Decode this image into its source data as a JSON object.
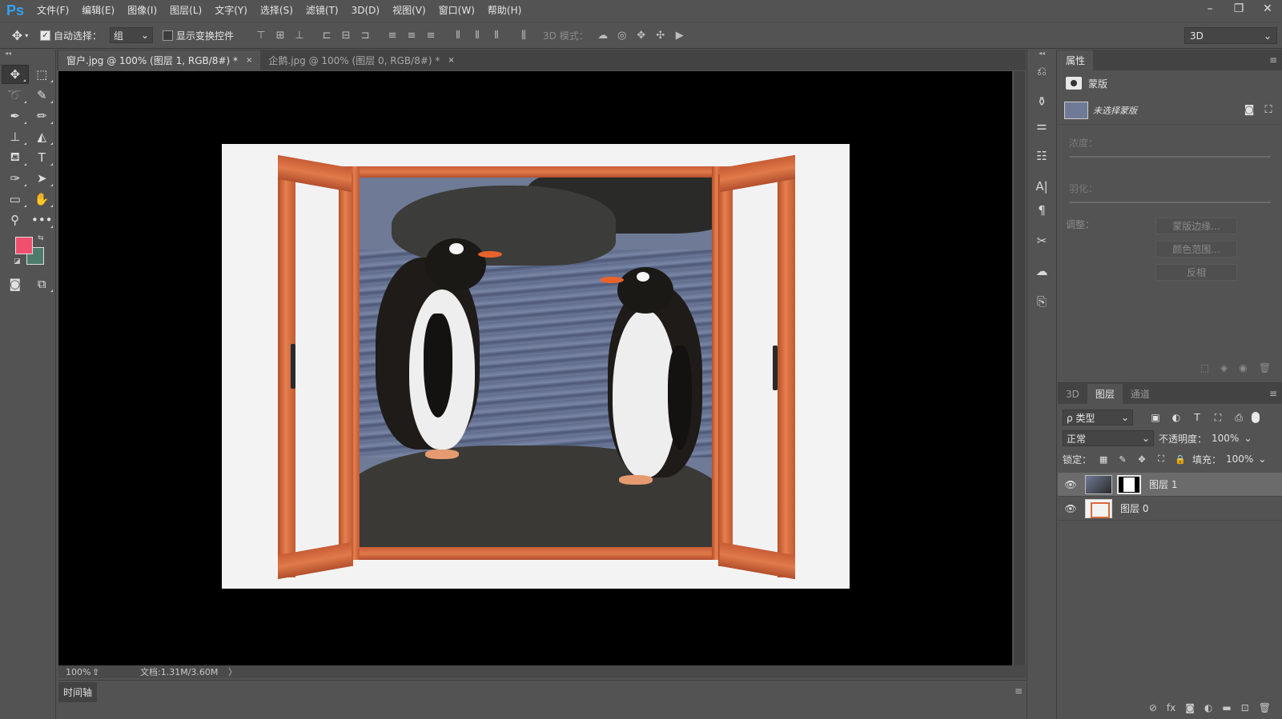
{
  "app": {
    "logo": "Ps",
    "menu": [
      "文件(F)",
      "编辑(E)",
      "图像(I)",
      "图层(L)",
      "文字(Y)",
      "选择(S)",
      "滤镜(T)",
      "3D(D)",
      "视图(V)",
      "窗口(W)",
      "帮助(H)"
    ],
    "window_controls": [
      "–",
      "❐",
      "✕"
    ]
  },
  "options": {
    "auto_select_label": "自动选择：",
    "auto_select_checked": true,
    "auto_select_value": "组",
    "show_transform_label": "显示变换控件",
    "mode_3d_label": "3D 模式：",
    "workspace": "3D"
  },
  "documents": {
    "tabs": [
      {
        "label": "窗户.jpg @ 100% (图层 1, RGB/8#) *",
        "close": "×",
        "active": true
      },
      {
        "label": "企鹅.jpg @ 100% (图层 0, RGB/8#) *",
        "close": "×",
        "active": false
      }
    ]
  },
  "status": {
    "zoom": "100%",
    "doc_info": "文档:1.31M/3.60M",
    "arrow": "〉"
  },
  "timeline": {
    "tab": "时间轴",
    "menu": "≡"
  },
  "colors": {
    "foreground": "#f0506e",
    "background": "#4e7b6c",
    "canvas": "#000000",
    "accent_logo": "#33a3f1"
  },
  "properties": {
    "tab": "属性",
    "header": "蒙版",
    "mask_label": "未选择蒙版",
    "density_label": "浓度：",
    "feather_label": "羽化：",
    "adjust_label": "调整：",
    "buttons": [
      "蒙版边缘...",
      "颜色范围...",
      "反相"
    ]
  },
  "layers_panel": {
    "tabs": [
      {
        "label": "3D",
        "active": false
      },
      {
        "label": "图层",
        "active": true
      },
      {
        "label": "通道",
        "active": false
      }
    ],
    "filter_label": "ρ 类型",
    "blend_mode": "正常",
    "opacity_label": "不透明度：",
    "opacity_value": "100%",
    "lock_label": "锁定：",
    "fill_label": "填充：",
    "fill_value": "100%",
    "layers": [
      {
        "name": "图层 1",
        "selected": true,
        "has_mask": true
      },
      {
        "name": "图层 0",
        "selected": false,
        "has_mask": false
      }
    ]
  }
}
